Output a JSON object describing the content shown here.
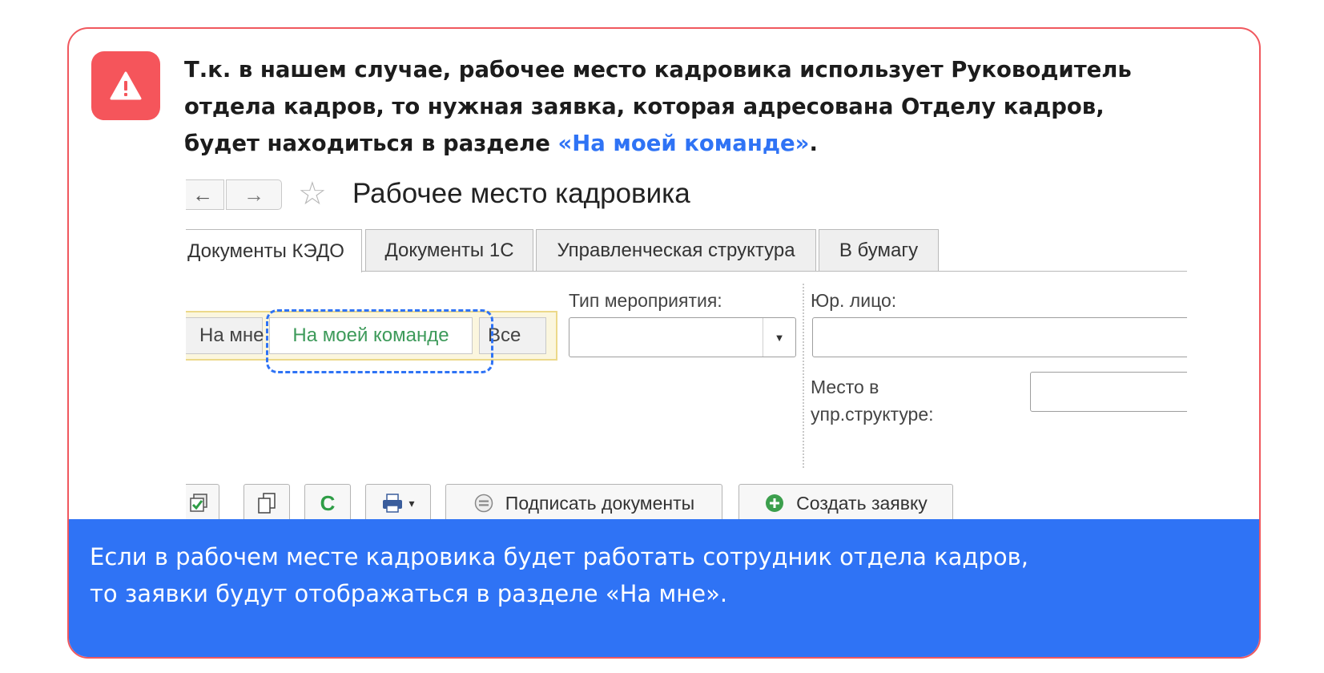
{
  "callout": {
    "message_lines": [
      "Т.к. в нашем случае, рабочее место кадровика использует Руководитель",
      "отдела кадров, то нужная заявка, которая адресована Отделу кадров,",
      "будет находиться в разделе "
    ],
    "highlight": "«На моей команде»",
    "highlight_suffix": ".",
    "footer_lines": [
      "Если в рабочем месте кадровика будет работать сотрудник отдела кадров,",
      "то заявки будут отображаться в разделе «На мне»."
    ],
    "colors": {
      "border": "#f0585e",
      "badge": "#f5555b",
      "accent": "#2f73f5",
      "footer_bg": "#2f73f5"
    },
    "icon": "warning-triangle-icon"
  },
  "window": {
    "title": "Рабочее место кадровика",
    "nav_back": "←",
    "nav_forward": "→",
    "favorite_icon": "☆"
  },
  "tabs": [
    {
      "label": "Документы КЭДО",
      "active": true
    },
    {
      "label": "Документы 1С",
      "active": false
    },
    {
      "label": "Управленческая структура",
      "active": false
    },
    {
      "label": "В бумагу",
      "active": false
    }
  ],
  "filters": {
    "segments": [
      {
        "label": "На мне",
        "selected": false
      },
      {
        "label": "На моей команде",
        "selected": true
      },
      {
        "label": "Все",
        "selected": false
      }
    ],
    "event_type_label": "Тип мероприятия:",
    "event_type_value": "",
    "legal_entity_label": "Юр. лицо:",
    "legal_entity_value": "",
    "position_label_line1": "Место в",
    "position_label_line2": "упр.структуре:",
    "position_value": ""
  },
  "toolbar": {
    "sign_label": "Подписать документы",
    "create_label": "Создать заявку",
    "refresh_glyph": "C",
    "dropdown_glyph": "▾"
  }
}
